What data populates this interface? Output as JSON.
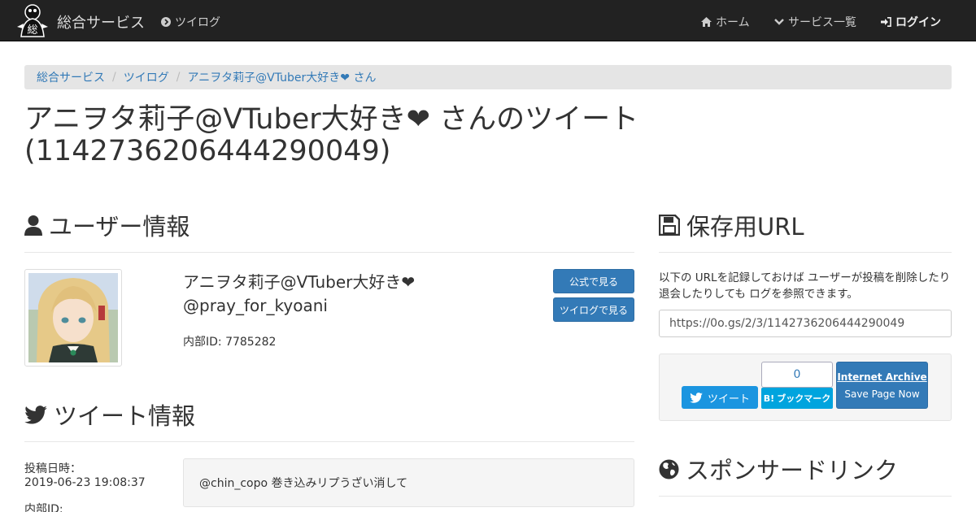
{
  "navbar": {
    "logo_text": "総",
    "brand": "総合サービス",
    "twilog_link": "ツイログ",
    "home": "ホーム",
    "services": "サービス一覧",
    "login": "ログイン"
  },
  "breadcrumb": [
    "総合サービス",
    "ツイログ",
    "アニヲタ莉子@VTuber大好き❤ さん"
  ],
  "page_title": "アニヲタ莉子@VTuber大好き❤ さんのツイート (1142736206444290049)",
  "user_section": {
    "heading": "ユーザー情報",
    "name": "アニヲタ莉子@VTuber大好き❤",
    "handle": "@pray_for_kyoani",
    "internal_id": "内部ID: 7785282",
    "btn_official": "公式で見る",
    "btn_twilog": "ツイログで見る"
  },
  "tweet_section": {
    "heading": "ツイート情報",
    "posted_label": "投稿日時：",
    "posted_value": "2019-06-23 19:08:37",
    "internal_id_label": "内部ID:",
    "text": "@chin_copo 巻き込みリプうざい消して"
  },
  "save_section": {
    "heading": "保存用URL",
    "description": "以下の URLを記録しておけば ユーザーが投稿を削除したり 退会したりしても ログを参照できます。",
    "url": "https://0o.gs/2/3/1142736206444290049"
  },
  "share": {
    "tweet_button": "ツイート",
    "hatena_count": "0",
    "hatena_label": "ブックマーク",
    "hatena_mark": "B!",
    "ia_title": "Internet Archive",
    "ia_action": "Save Page Now"
  },
  "sponsor_section": {
    "heading": "スポンサードリンク"
  },
  "colors": {
    "navbar_bg": "#222222",
    "link": "#337ab7",
    "primary_button": "#337ab7",
    "twitter": "#1b95e0",
    "hatena": "#00a4de"
  }
}
